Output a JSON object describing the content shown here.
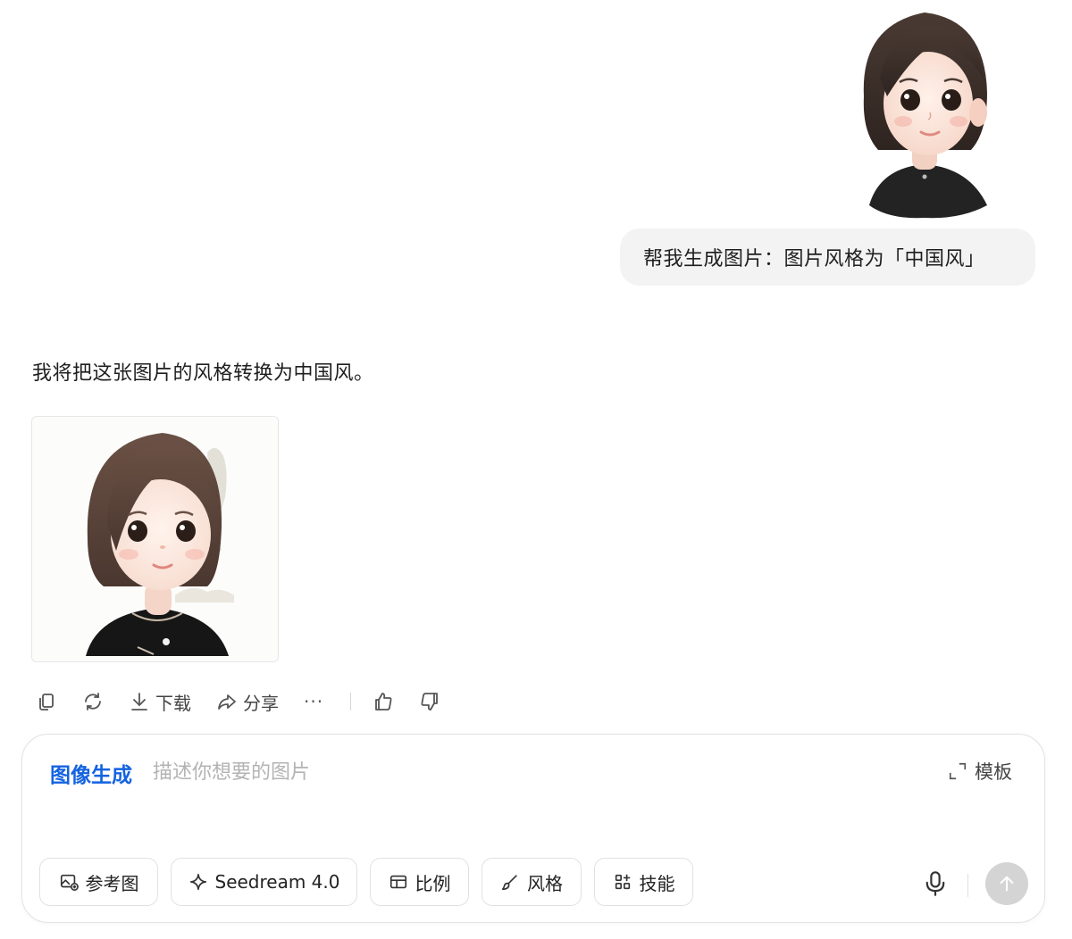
{
  "conversation": {
    "user_message": "帮我生成图片：图片风格为「中国风」",
    "assistant_message": "我将把这张图片的风格转换为中国风。"
  },
  "actions": {
    "download": "下载",
    "share": "分享",
    "more": "···"
  },
  "composer": {
    "mode": "图像生成",
    "placeholder": "描述你想要的图片",
    "template": "模板",
    "chips": {
      "reference": "参考图",
      "model": "Seedream 4.0",
      "ratio": "比例",
      "style": "风格",
      "skills": "技能"
    }
  },
  "colors": {
    "accent": "#1463e0",
    "bubble": "#f3f3f4",
    "send_disabled": "#d4d4d4"
  }
}
